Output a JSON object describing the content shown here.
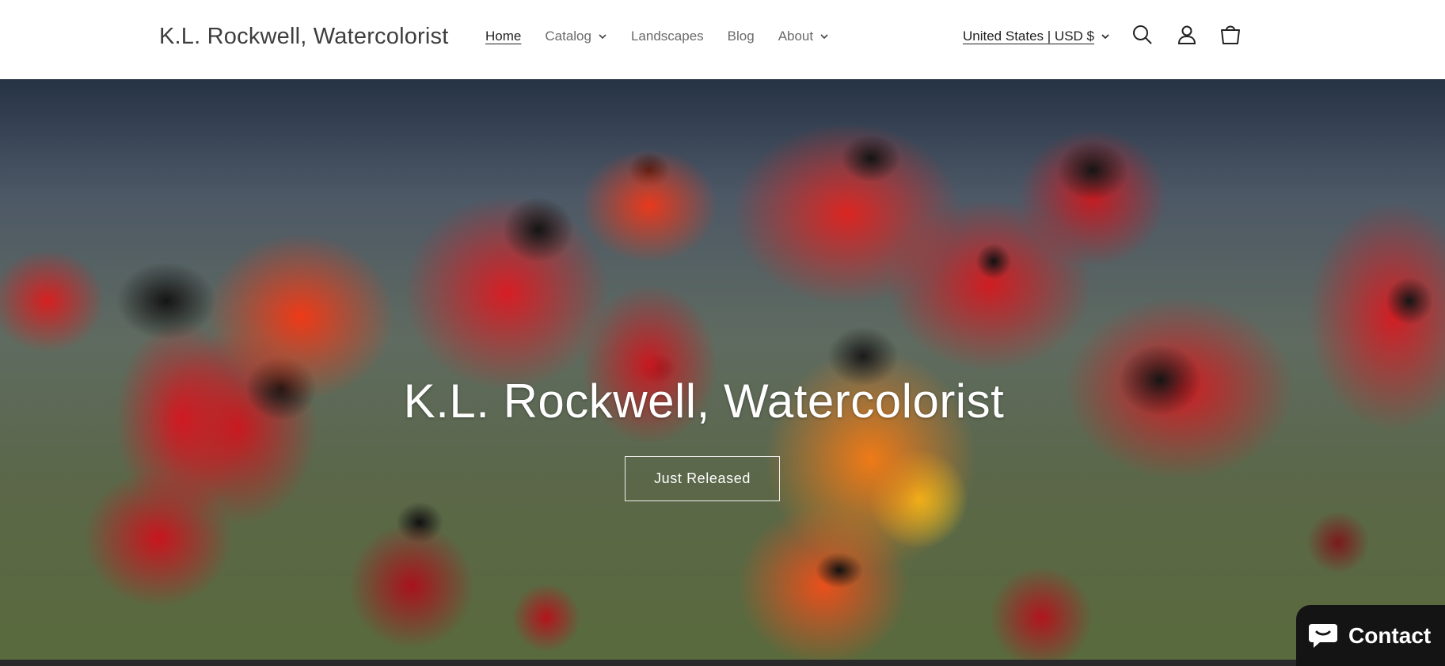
{
  "header": {
    "logo": "K.L. Rockwell, Watercolorist",
    "nav": [
      {
        "label": "Home",
        "active": true,
        "dropdown": false
      },
      {
        "label": "Catalog",
        "active": false,
        "dropdown": true
      },
      {
        "label": "Landscapes",
        "active": false,
        "dropdown": false
      },
      {
        "label": "Blog",
        "active": false,
        "dropdown": false
      },
      {
        "label": "About",
        "active": false,
        "dropdown": true
      }
    ],
    "currency": "United States | USD $",
    "icons": [
      "search-icon",
      "account-icon",
      "cart-icon"
    ]
  },
  "hero": {
    "title": "K.L. Rockwell, Watercolorist",
    "button_label": "Just Released",
    "image_subject": "watercolor painting of red poppies"
  },
  "chat_widget": {
    "label": "Contact",
    "icon": "chat-bubble-icon"
  },
  "colors": {
    "header_bg": "#ffffff",
    "logo_text": "#3e3e3e",
    "nav_text": "#6a6a6a",
    "hero_text": "#ffffff",
    "chat_bg": "#141414"
  }
}
